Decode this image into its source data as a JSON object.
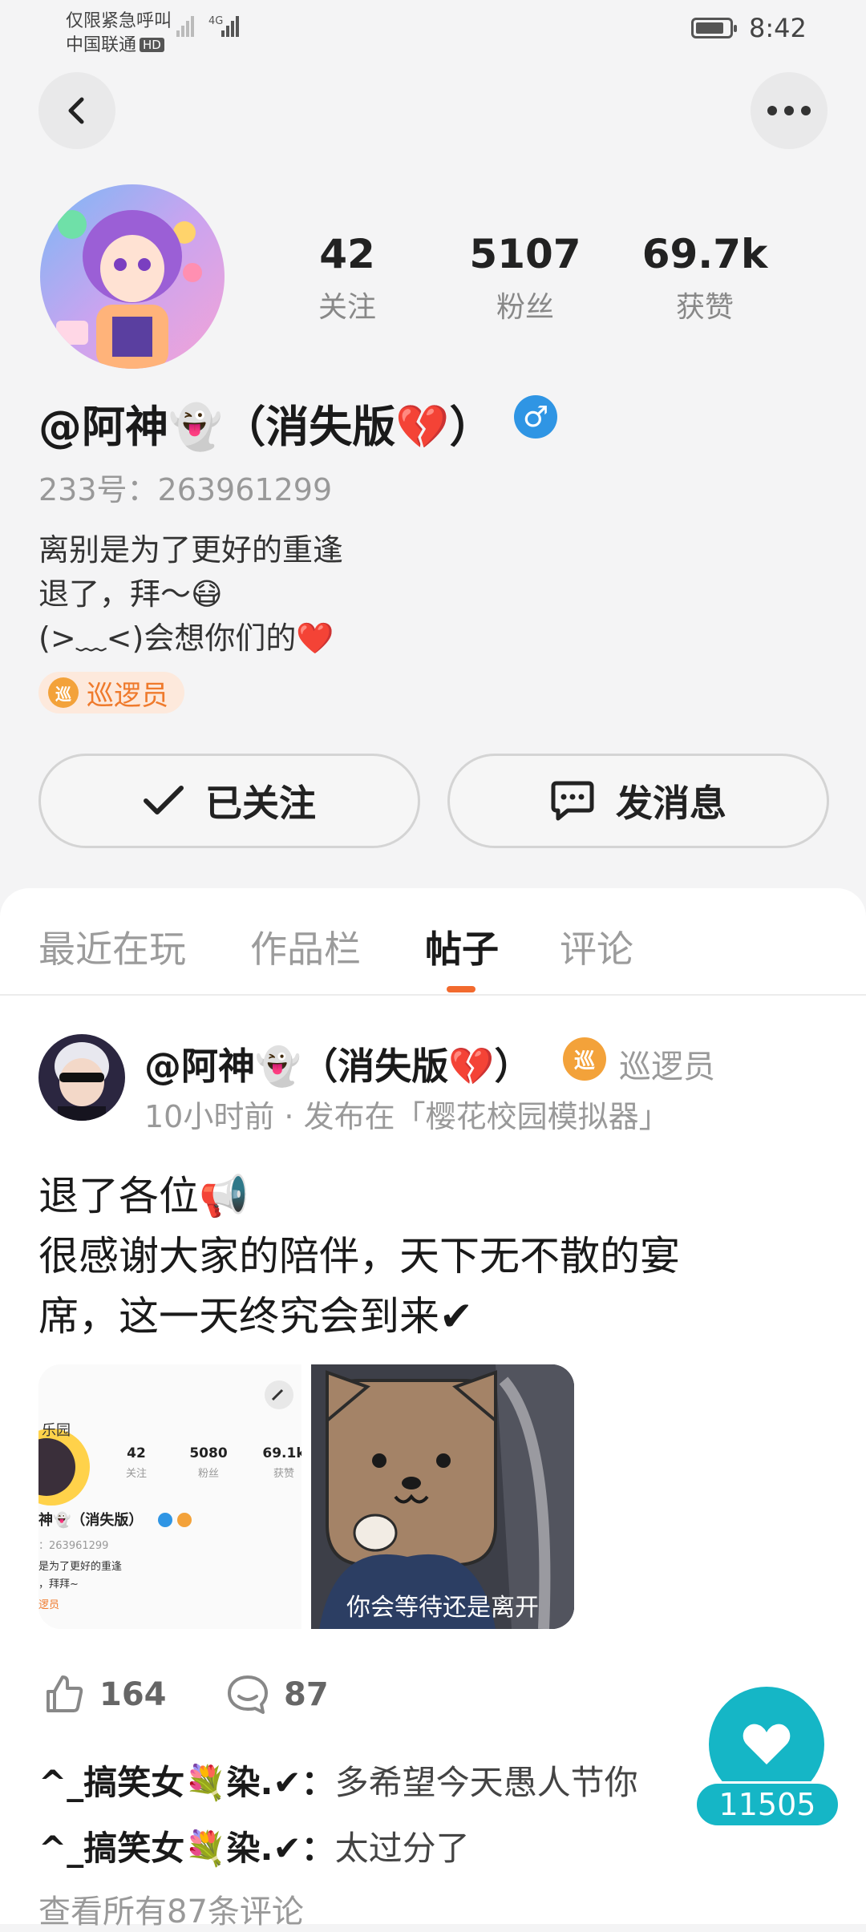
{
  "status_bar": {
    "carrier_line1": "仅限紧急呼叫",
    "carrier_line2": "中国联通",
    "hd_label": "HD",
    "network": "4G",
    "time": "8:42"
  },
  "profile": {
    "stats": [
      {
        "value": "42",
        "label": "关注"
      },
      {
        "value": "5107",
        "label": "粉丝"
      },
      {
        "value": "69.7k",
        "label": "获赞"
      }
    ],
    "name": "@阿神👻（消失版💔）",
    "gender_symbol": "♂",
    "uid": "233号：263961299",
    "bio_lines": [
      "离别是为了更好的重逢",
      "退了，拜～😷",
      "(>﹏<)会想你们的❤️"
    ],
    "badge": "巡逻员",
    "badge_icon_char": "巡",
    "follow_label": "已关注",
    "message_label": "发消息"
  },
  "tabs": [
    {
      "label": "最近在玩",
      "active": false
    },
    {
      "label": "作品栏",
      "active": false
    },
    {
      "label": "帖子",
      "active": true
    },
    {
      "label": "评论",
      "active": false
    }
  ],
  "post": {
    "author": "@阿神👻（消失版💔）",
    "badge_icon_char": "巡",
    "badge": "巡逻员",
    "meta": "10小时前 · 发布在「樱花校园模拟器」",
    "body_lines": [
      "退了各位📢",
      "很感谢大家的陪伴，天下无不散的宴",
      "席，这一天终究会到来✔"
    ],
    "image1": {
      "logo_text": "乐园",
      "stats": [
        {
          "value": "42",
          "label": "关注"
        },
        {
          "value": "5080",
          "label": "粉丝"
        },
        {
          "value": "69.1k",
          "label": "获赞"
        }
      ],
      "name": "神👻（消失版）",
      "uid": "：263961299",
      "bio1": "是为了更好的重逢",
      "bio2": "，拜拜~",
      "badge": "逻员"
    },
    "image2_caption": "你会等待还是离开",
    "likes": "164",
    "comments_count": "87",
    "comments": [
      {
        "user": "^_搞笑女💐染.✔：",
        "text": "多希望今天愚人节你"
      },
      {
        "user": "^_搞笑女💐染.✔：",
        "text": "太过分了"
      }
    ],
    "view_all": "查看所有87条评论"
  },
  "fab": {
    "count": "11505"
  },
  "colors": {
    "accent_orange": "#f26a2e",
    "fab_teal": "#15b6c6",
    "gender_blue": "#2f95e4"
  }
}
